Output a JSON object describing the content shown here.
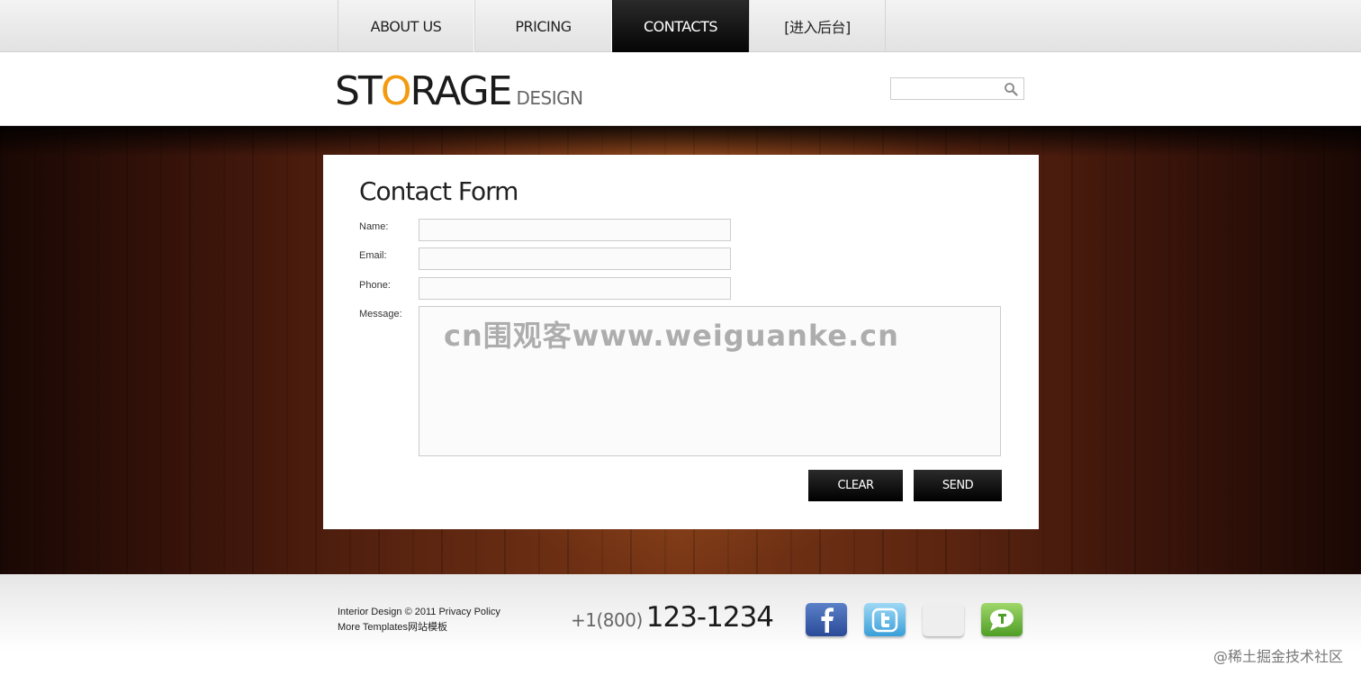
{
  "nav": {
    "items": [
      {
        "label": "ABOUT US"
      },
      {
        "label": "PRICING"
      },
      {
        "label": "CONTACTS"
      },
      {
        "label": "[进入后台]"
      }
    ]
  },
  "logo": {
    "first": "ST",
    "o": "O",
    "rest": "RAGE",
    "sub": "DESIGN"
  },
  "search": {
    "value": ""
  },
  "form": {
    "title": "Contact Form",
    "name_label": "Name:",
    "email_label": "Email:",
    "phone_label": "Phone:",
    "message_label": "Message:",
    "name_value": "",
    "email_value": "",
    "phone_value": "",
    "message_value": "",
    "watermark": "cn围观客www.weiguanke.cn",
    "clear_label": "CLEAR",
    "send_label": "SEND"
  },
  "footer": {
    "line1": "Interior Design © 2011 Privacy Policy",
    "line2": "More Templates网站模板",
    "phone_code": "+1(800)",
    "phone_number": "123-1234"
  },
  "credit": "@稀土掘金技术社区",
  "colors": {
    "accent": "#f29b10",
    "nav_active": "#111111"
  }
}
